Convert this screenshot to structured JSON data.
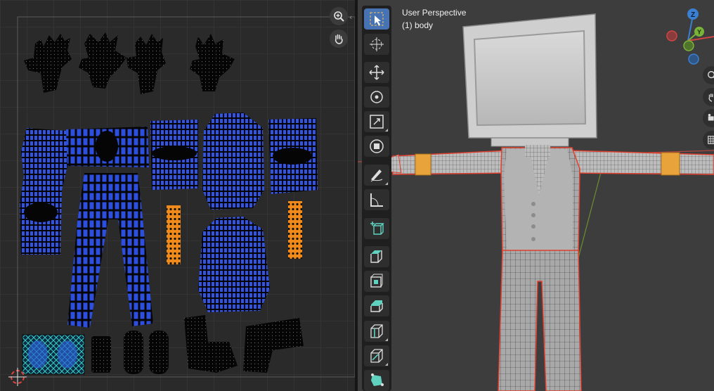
{
  "uv_editor": {
    "tools": [
      {
        "name": "zoom",
        "icon": "zoom-icon"
      },
      {
        "name": "pan",
        "icon": "hand-icon"
      }
    ],
    "colors": {
      "grid_bg": "#2a2a2a",
      "island_blue": "#2d4fe0",
      "island_orange": "#f08a1a",
      "island_black": "#050505",
      "cursor_red": "#e0443e"
    }
  },
  "viewport": {
    "view_name": "User Perspective",
    "object_name": "(1) body",
    "colors": {
      "background": "#3d3d3d",
      "selection_outline": "#e0402f",
      "sleeve_band": "#e8a33a",
      "floor_x_axis": "#b0453f",
      "floor_y_axis": "#6b8f2f"
    },
    "toolbar": [
      {
        "name": "select-box",
        "icon": "select-box-icon",
        "active": true
      },
      {
        "name": "cursor",
        "icon": "cursor-icon",
        "active": false
      },
      {
        "name": "move",
        "icon": "move-icon",
        "active": false
      },
      {
        "name": "rotate",
        "icon": "rotate-icon",
        "active": false
      },
      {
        "name": "scale",
        "icon": "scale-icon",
        "active": false
      },
      {
        "name": "transform",
        "icon": "transform-icon",
        "active": false
      },
      {
        "name": "annotate",
        "icon": "annotate-icon",
        "active": false
      },
      {
        "name": "measure",
        "icon": "measure-icon",
        "active": false
      },
      {
        "name": "add-cube",
        "icon": "add-cube-icon",
        "active": false
      },
      {
        "name": "extrude",
        "icon": "extrude-icon",
        "active": false
      },
      {
        "name": "inset",
        "icon": "inset-icon",
        "active": false
      },
      {
        "name": "bevel",
        "icon": "bevel-icon",
        "active": false
      },
      {
        "name": "loop-cut",
        "icon": "loop-cut-icon",
        "active": false
      },
      {
        "name": "knife",
        "icon": "knife-icon",
        "active": false
      },
      {
        "name": "poly-build",
        "icon": "poly-build-icon",
        "active": false
      }
    ],
    "gizmo_axes": [
      "Z",
      "Y"
    ],
    "side_buttons": [
      "zoom-icon",
      "hand-icon",
      "camera-icon",
      "grid-icon"
    ]
  }
}
